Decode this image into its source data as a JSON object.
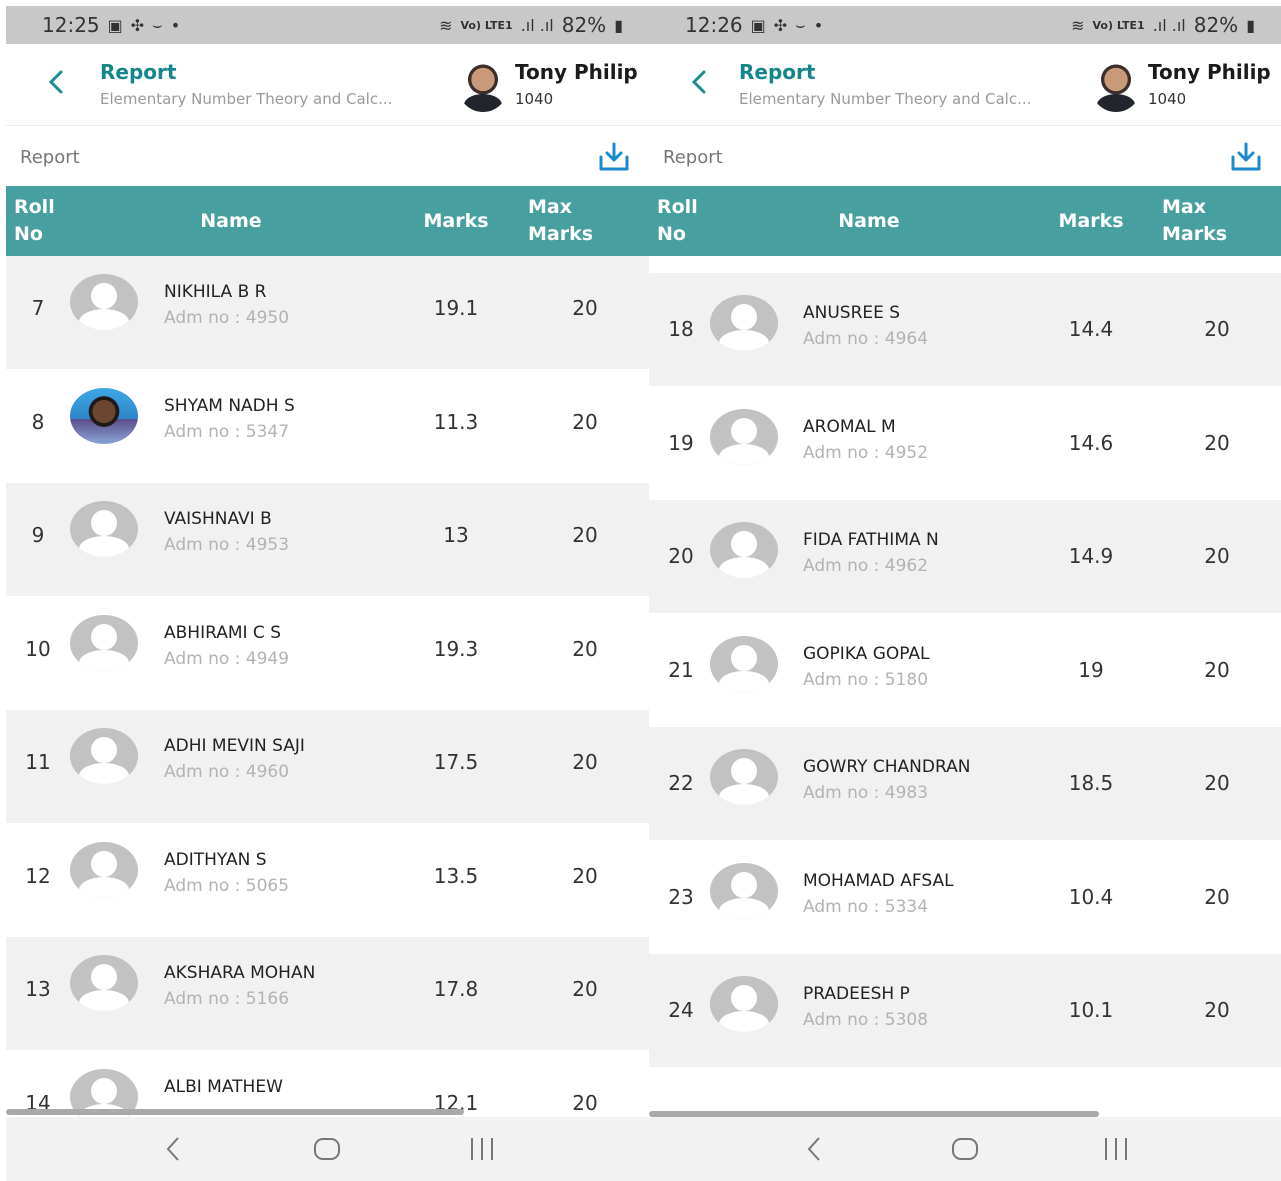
{
  "screens": [
    {
      "status": {
        "time": "12:25",
        "battery": "82%",
        "network_label": "Vo) LTE1"
      },
      "header": {
        "title": "Report",
        "subtitle": "Elementary Number Theory and Calc...",
        "user_name": "Tony Philip",
        "user_id": "1040"
      },
      "report_label": "Report",
      "columns": {
        "roll": "Roll No",
        "name": "Name",
        "marks": "Marks",
        "max": "Max Marks"
      },
      "rows": [
        {
          "roll": "7",
          "name": "NIKHILA B R",
          "adm": "Adm no : 4950",
          "marks": "19.1",
          "max": "20",
          "photo": false
        },
        {
          "roll": "8",
          "name": "SHYAM NADH S",
          "adm": "Adm no : 5347",
          "marks": "11.3",
          "max": "20",
          "photo": true
        },
        {
          "roll": "9",
          "name": "VAISHNAVI B",
          "adm": "Adm no : 4953",
          "marks": "13",
          "max": "20",
          "photo": false
        },
        {
          "roll": "10",
          "name": "ABHIRAMI C S",
          "adm": "Adm no : 4949",
          "marks": "19.3",
          "max": "20",
          "photo": false
        },
        {
          "roll": "11",
          "name": "ADHI MEVIN SAJI",
          "adm": "Adm no : 4960",
          "marks": "17.5",
          "max": "20",
          "photo": false
        },
        {
          "roll": "12",
          "name": "ADITHYAN S",
          "adm": "Adm no : 5065",
          "marks": "13.5",
          "max": "20",
          "photo": false
        },
        {
          "roll": "13",
          "name": "AKSHARA MOHAN",
          "adm": "Adm no : 5166",
          "marks": "17.8",
          "max": "20",
          "photo": false
        },
        {
          "roll": "14",
          "name": "ALBI MATHEW",
          "adm": "",
          "marks": "12.1",
          "max": "20",
          "photo": false
        }
      ]
    },
    {
      "status": {
        "time": "12:26",
        "battery": "82%",
        "network_label": "Vo) LTE1"
      },
      "header": {
        "title": "Report",
        "subtitle": "Elementary Number Theory and Calc...",
        "user_name": "Tony Philip",
        "user_id": "1040"
      },
      "report_label": "Report",
      "columns": {
        "roll": "Roll No",
        "name": "Name",
        "marks": "Marks",
        "max": "Max Marks"
      },
      "rows": [
        {
          "roll": "18",
          "name": "ANUSREE S",
          "adm": "Adm no : 4964",
          "marks": "14.4",
          "max": "20",
          "photo": false
        },
        {
          "roll": "19",
          "name": "AROMAL M",
          "adm": "Adm no : 4952",
          "marks": "14.6",
          "max": "20",
          "photo": false
        },
        {
          "roll": "20",
          "name": "FIDA FATHIMA N",
          "adm": "Adm no : 4962",
          "marks": "14.9",
          "max": "20",
          "photo": false
        },
        {
          "roll": "21",
          "name": "GOPIKA GOPAL",
          "adm": "Adm no : 5180",
          "marks": "19",
          "max": "20",
          "photo": false
        },
        {
          "roll": "22",
          "name": "GOWRY CHANDRAN",
          "adm": "Adm no : 4983",
          "marks": "18.5",
          "max": "20",
          "photo": false
        },
        {
          "roll": "23",
          "name": "MOHAMAD AFSAL",
          "adm": "Adm no : 5334",
          "marks": "10.4",
          "max": "20",
          "photo": false
        },
        {
          "roll": "24",
          "name": "PRADEESH P",
          "adm": "Adm no : 5308",
          "marks": "10.1",
          "max": "20",
          "photo": false
        },
        {
          "roll": "",
          "name": "",
          "adm": "",
          "marks": "",
          "max": "",
          "photo": false
        }
      ]
    }
  ],
  "theme": {
    "accent": "#14868b",
    "table_header": "#47a09f",
    "row_shade": "#f1f1f1"
  },
  "icons": {
    "back": "chevron-left-icon",
    "download": "download-icon",
    "nav_back": "nav-back-icon",
    "nav_home": "nav-home-icon",
    "nav_recents": "nav-recents-icon"
  }
}
